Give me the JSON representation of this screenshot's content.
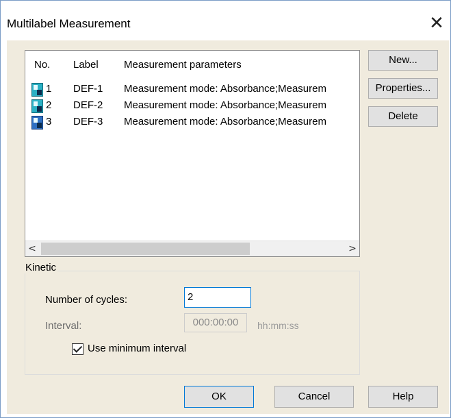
{
  "window": {
    "title": "Multilabel Measurement",
    "close_glyph": "✕"
  },
  "list": {
    "columns": [
      "No.",
      "Label",
      "Measurement parameters"
    ],
    "rows": [
      {
        "no": "1",
        "label": "DEF-1",
        "params": "Measurement mode: Absorbance;Measurem",
        "icon": "measurement-icon",
        "selected": false
      },
      {
        "no": "2",
        "label": "DEF-2",
        "params": "Measurement mode: Absorbance;Measurem",
        "icon": "measurement-icon",
        "selected": false
      },
      {
        "no": "3",
        "label": "DEF-3",
        "params": "Measurement mode: Absorbance;Measurem",
        "icon": "measurement-icon",
        "selected": true
      }
    ],
    "scroll_left_glyph": "<",
    "scroll_right_glyph": ">"
  },
  "side_buttons": {
    "new": "New...",
    "properties": "Properties...",
    "delete": "Delete"
  },
  "kinetic": {
    "title": "Kinetic",
    "cycles_label": "Number of cycles:",
    "cycles_value": "2",
    "interval_label": "Interval:",
    "interval_value": "000:00:00",
    "interval_unit": "hh:mm:ss",
    "use_min_label": "Use minimum interval",
    "use_min_checked": true
  },
  "footer": {
    "ok": "OK",
    "cancel": "Cancel",
    "help": "Help"
  },
  "colors": {
    "dialog_bg": "#f0ebde",
    "focus_border": "#0078d7"
  }
}
